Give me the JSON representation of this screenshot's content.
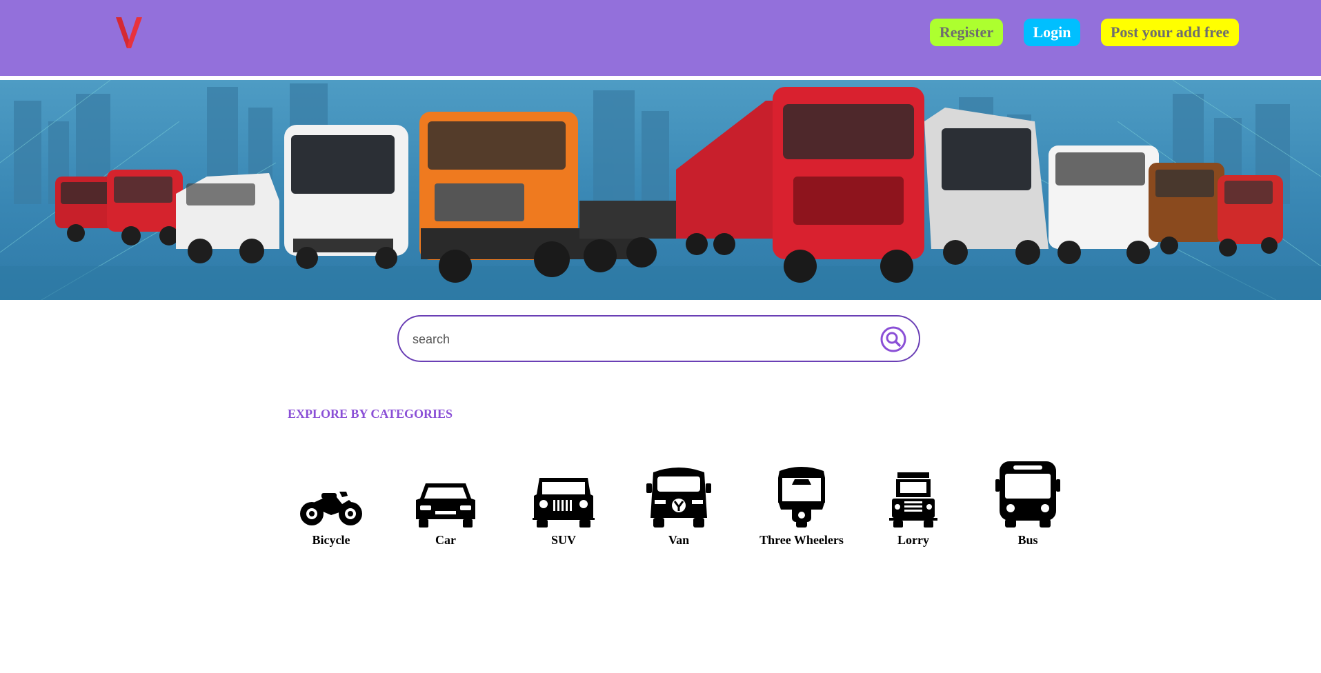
{
  "header": {
    "logo_text": "V",
    "register_label": "Register",
    "login_label": "Login",
    "post_label": "Post your add free"
  },
  "search": {
    "placeholder": "search"
  },
  "categories": {
    "title": "EXPLORE BY CATEGORIES",
    "items": [
      {
        "label": "Bicycle",
        "icon": "motorcycle-icon"
      },
      {
        "label": "Car",
        "icon": "car-icon"
      },
      {
        "label": "SUV",
        "icon": "suv-icon"
      },
      {
        "label": "Van",
        "icon": "van-icon"
      },
      {
        "label": "Three Wheelers",
        "icon": "auto-rickshaw-icon"
      },
      {
        "label": "Lorry",
        "icon": "lorry-icon"
      },
      {
        "label": "Bus",
        "icon": "bus-icon"
      }
    ]
  },
  "colors": {
    "header_bg": "#9370db",
    "register_bg": "#adff2f",
    "login_bg": "#00bfff",
    "post_bg": "#ffff00",
    "accent": "#8a4fd6"
  }
}
